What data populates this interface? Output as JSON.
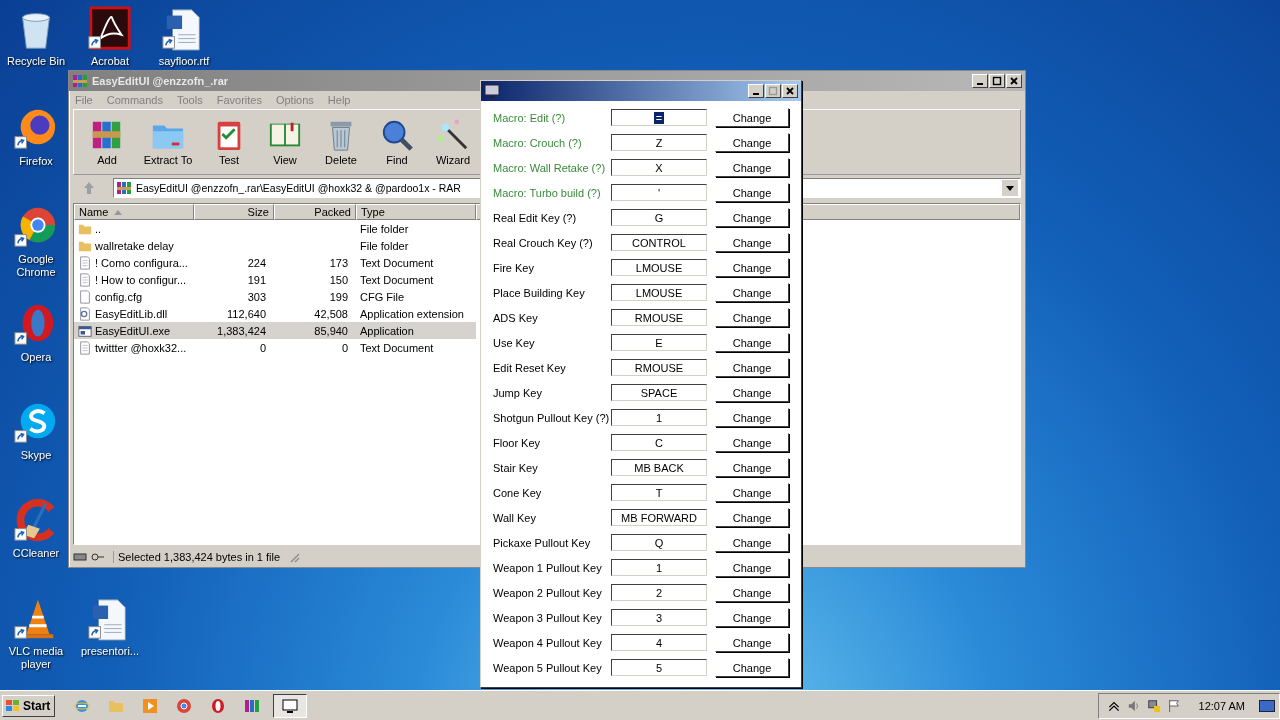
{
  "desktop_icons": [
    {
      "label": "Recycle Bin",
      "kind": "bin"
    },
    {
      "label": "Acrobat",
      "kind": "acrobat"
    },
    {
      "label": "sayfloor.rtf",
      "kind": "doc"
    },
    {
      "label": "Firefox",
      "kind": "firefox"
    },
    {
      "label": "Google Chrome",
      "kind": "chrome"
    },
    {
      "label": "Opera",
      "kind": "opera"
    },
    {
      "label": "Skype",
      "kind": "skype"
    },
    {
      "label": "CCleaner",
      "kind": "ccleaner"
    },
    {
      "label": "VLC media player",
      "kind": "vlc"
    },
    {
      "label": "presentori...",
      "kind": "doc"
    }
  ],
  "archive_window": {
    "title": "EasyEditUI @enzzofn_.rar",
    "menu": [
      "File",
      "Commands",
      "Tools",
      "Favorites",
      "Options",
      "Help"
    ],
    "toolbar": [
      {
        "label": "Add",
        "kind": "add"
      },
      {
        "label": "Extract To",
        "kind": "extract"
      },
      {
        "label": "Test",
        "kind": "test"
      },
      {
        "label": "View",
        "kind": "view"
      },
      {
        "label": "Delete",
        "kind": "delete"
      },
      {
        "label": "Find",
        "kind": "find"
      },
      {
        "label": "Wizard",
        "kind": "wizard"
      }
    ],
    "path": "EasyEditUI @enzzofn_.rar\\EasyEditUI @hoxk32 & @pardoo1x - RAR",
    "columns": [
      "Name",
      "Size",
      "Packed",
      "Type"
    ],
    "rows": [
      {
        "name": "..",
        "size": "",
        "packed": "",
        "type": "File folder",
        "kind": "folder",
        "selected": false
      },
      {
        "name": "wallretake delay",
        "size": "",
        "packed": "",
        "type": "File folder",
        "kind": "folder",
        "selected": false
      },
      {
        "name": "! Como configura...",
        "size": "224",
        "packed": "173",
        "type": "Text Document",
        "kind": "text",
        "selected": false
      },
      {
        "name": "! How to configur...",
        "size": "191",
        "packed": "150",
        "type": "Text Document",
        "kind": "text",
        "selected": false
      },
      {
        "name": "config.cfg",
        "size": "303",
        "packed": "199",
        "type": "CFG File",
        "kind": "file",
        "selected": false
      },
      {
        "name": "EasyEditLib.dll",
        "size": "112,640",
        "packed": "42,508",
        "type": "Application extension",
        "kind": "dll",
        "selected": false
      },
      {
        "name": "EasyEditUI.exe",
        "size": "1,383,424",
        "packed": "85,940",
        "type": "Application",
        "kind": "exe",
        "selected": true
      },
      {
        "name": "twittter @hoxk32...",
        "size": "0",
        "packed": "0",
        "type": "Text Document",
        "kind": "text",
        "selected": false
      }
    ],
    "status": "Selected 1,383,424 bytes in 1 file"
  },
  "keys_dialog": {
    "rows": [
      {
        "label": "Macro: Edit (?)",
        "value": "=",
        "kind": "macro",
        "selected": true,
        "button": "Change"
      },
      {
        "label": "Macro: Crouch (?)",
        "value": "Z",
        "kind": "macro",
        "selected": false,
        "button": "Change"
      },
      {
        "label": "Macro: Wall Retake (?)",
        "value": "X",
        "kind": "macro",
        "selected": false,
        "button": "Change"
      },
      {
        "label": "Macro: Turbo build (?)",
        "value": "'",
        "kind": "macro",
        "selected": false,
        "button": "Change"
      },
      {
        "label": "Real Edit Key (?)",
        "value": "G",
        "kind": "key",
        "selected": false,
        "button": "Change"
      },
      {
        "label": "Real Crouch Key (?)",
        "value": "CONTROL",
        "kind": "key",
        "selected": false,
        "button": "Change"
      },
      {
        "label": "Fire Key",
        "value": "LMOUSE",
        "kind": "key",
        "selected": false,
        "button": "Change"
      },
      {
        "label": "Place Building Key",
        "value": "LMOUSE",
        "kind": "key",
        "selected": false,
        "button": "Change"
      },
      {
        "label": "ADS Key",
        "value": "RMOUSE",
        "kind": "key",
        "selected": false,
        "button": "Change"
      },
      {
        "label": "Use Key",
        "value": "E",
        "kind": "key",
        "selected": false,
        "button": "Change"
      },
      {
        "label": "Edit Reset Key",
        "value": "RMOUSE",
        "kind": "key",
        "selected": false,
        "button": "Change"
      },
      {
        "label": "Jump Key",
        "value": "SPACE",
        "kind": "key",
        "selected": false,
        "button": "Change"
      },
      {
        "label": "Shotgun Pullout Key (?)",
        "value": "1",
        "kind": "key",
        "selected": false,
        "button": "Change"
      },
      {
        "label": "Floor Key",
        "value": "C",
        "kind": "key",
        "selected": false,
        "button": "Change"
      },
      {
        "label": "Stair Key",
        "value": "MB BACK",
        "kind": "key",
        "selected": false,
        "button": "Change"
      },
      {
        "label": "Cone Key",
        "value": "T",
        "kind": "key",
        "selected": false,
        "button": "Change"
      },
      {
        "label": "Wall Key",
        "value": "MB FORWARD",
        "kind": "key",
        "selected": false,
        "button": "Change"
      },
      {
        "label": "Pickaxe Pullout Key",
        "value": "Q",
        "kind": "key",
        "selected": false,
        "button": "Change"
      },
      {
        "label": "Weapon 1 Pullout Key",
        "value": "1",
        "kind": "key",
        "selected": false,
        "button": "Change"
      },
      {
        "label": "Weapon 2 Pullout Key",
        "value": "2",
        "kind": "key",
        "selected": false,
        "button": "Change"
      },
      {
        "label": "Weapon 3 Pullout Key",
        "value": "3",
        "kind": "key",
        "selected": false,
        "button": "Change"
      },
      {
        "label": "Weapon 4 Pullout Key",
        "value": "4",
        "kind": "key",
        "selected": false,
        "button": "Change"
      },
      {
        "label": "Weapon 5 Pullout Key",
        "value": "5",
        "kind": "key",
        "selected": false,
        "button": "Change"
      }
    ]
  },
  "taskbar": {
    "start": "Start",
    "clock": "12:07 AM",
    "apps": [
      {
        "kind": "ie",
        "active": false
      },
      {
        "kind": "explorer",
        "active": false
      },
      {
        "kind": "media",
        "active": false
      },
      {
        "kind": "chrome",
        "active": false
      },
      {
        "kind": "opera",
        "active": false
      },
      {
        "kind": "winrar",
        "active": false
      },
      {
        "kind": "app",
        "active": true
      }
    ]
  }
}
